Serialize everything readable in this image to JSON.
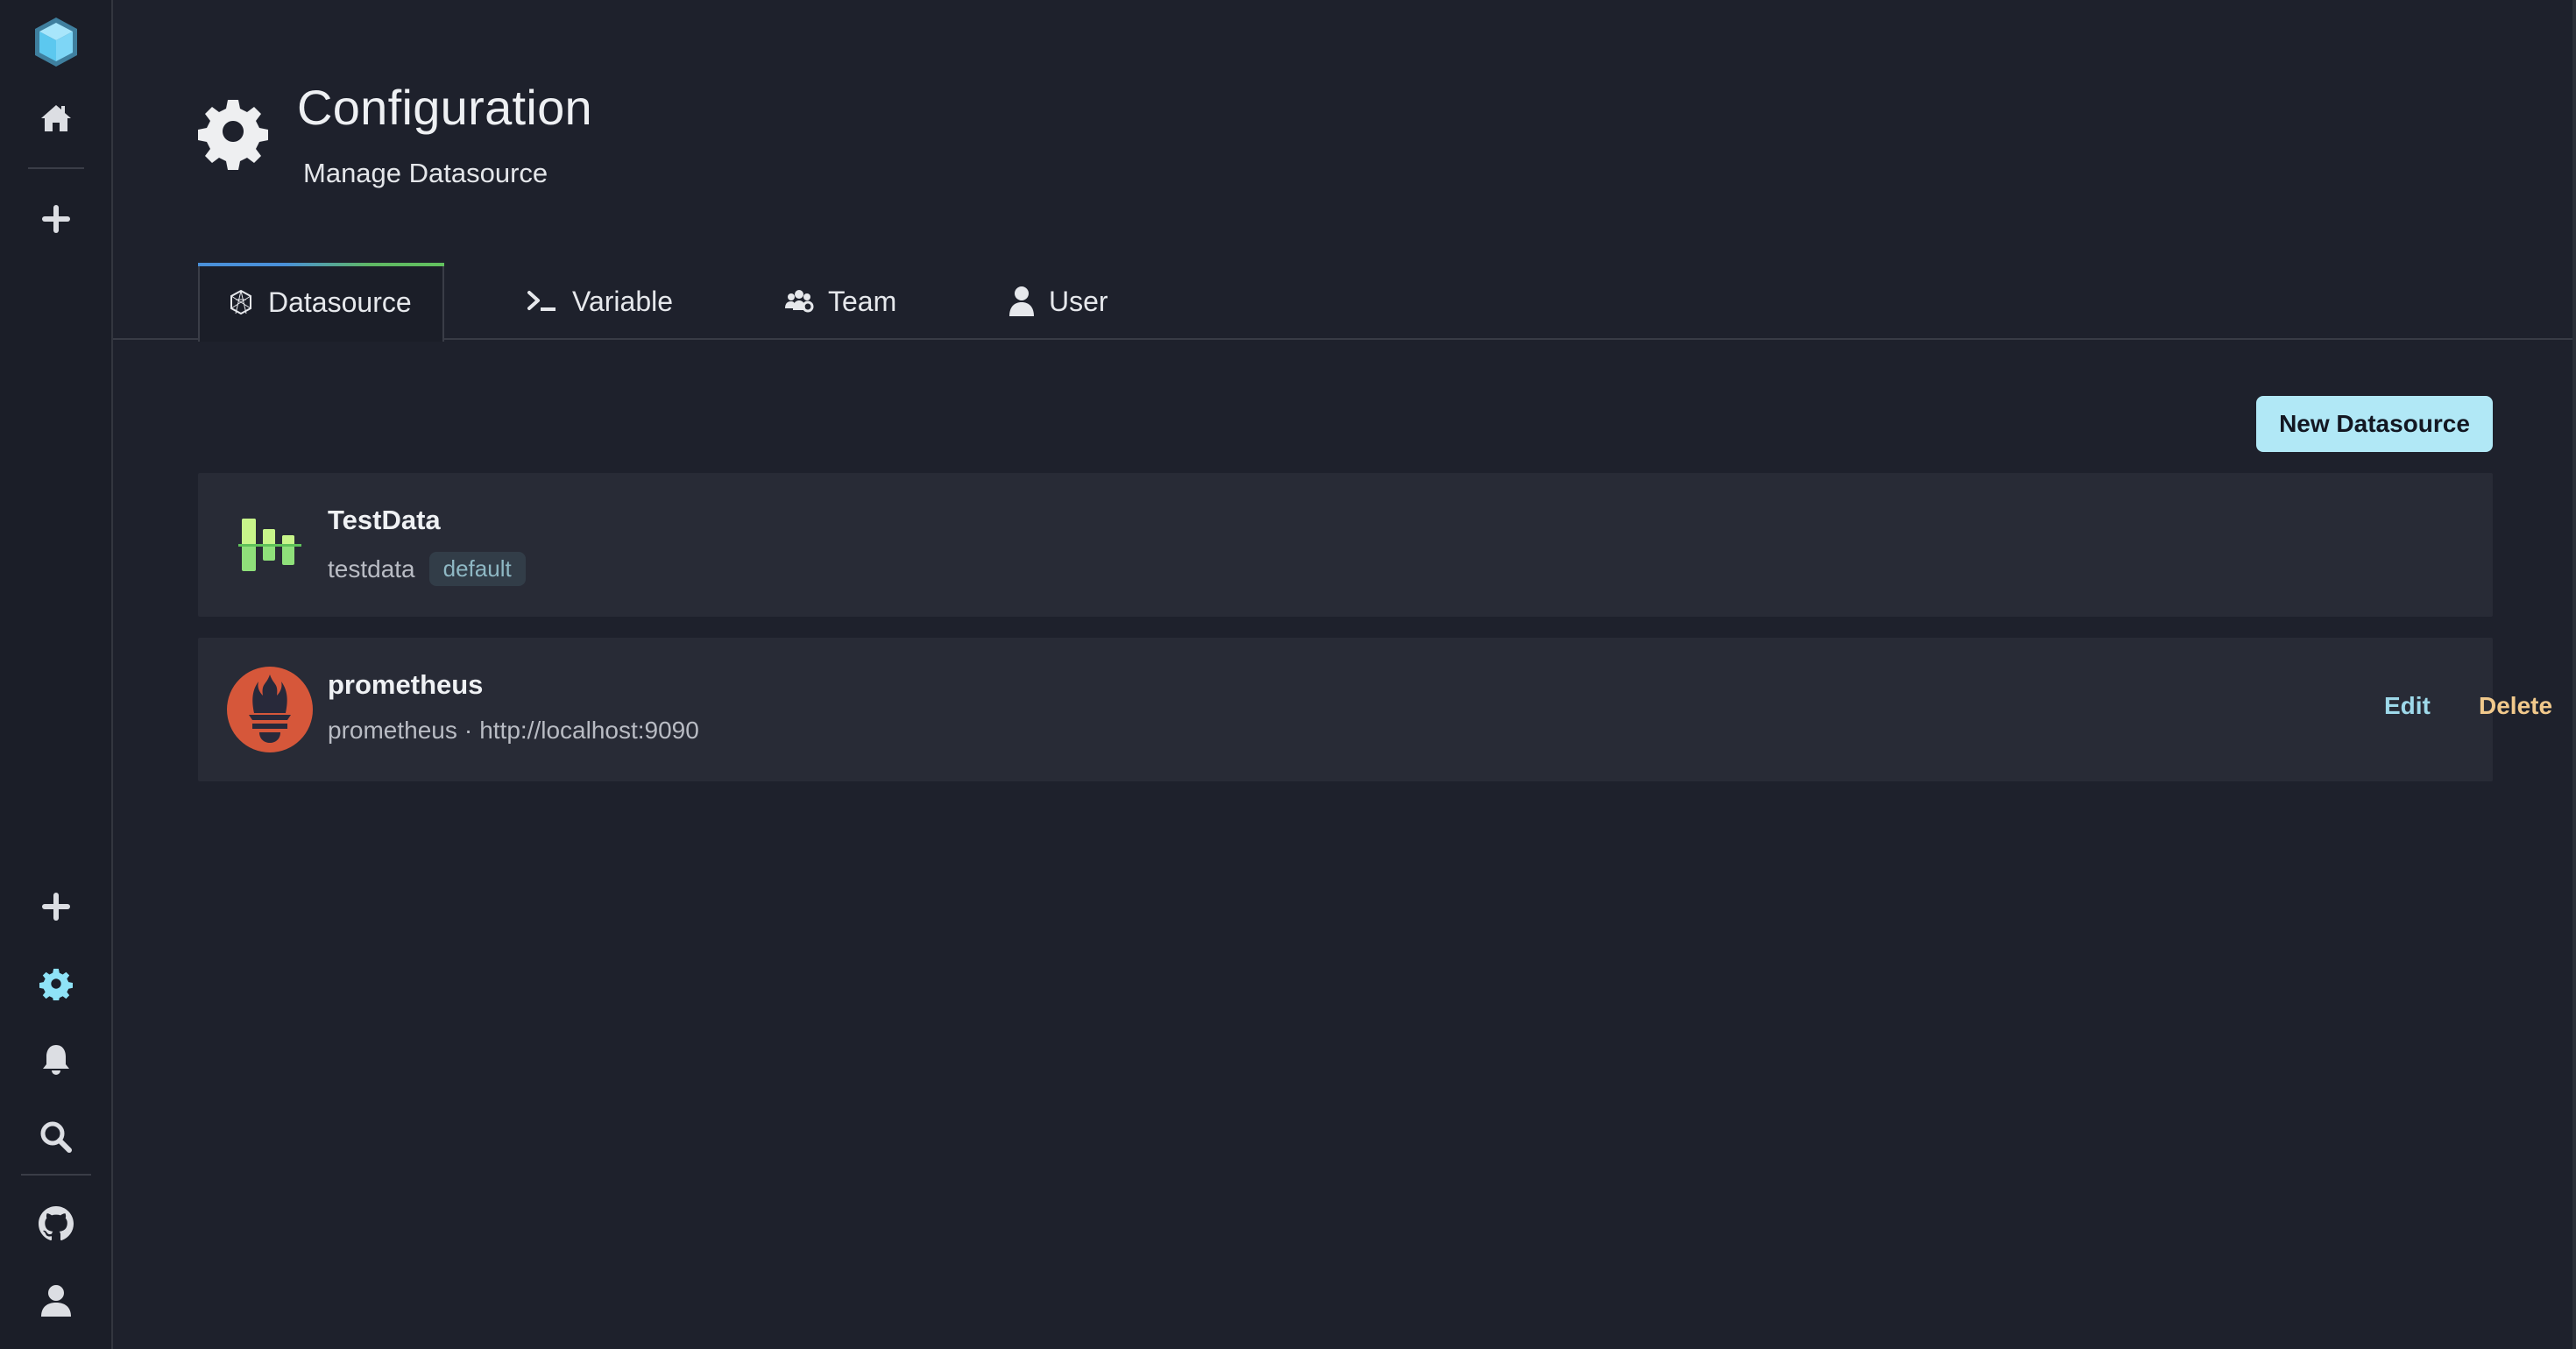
{
  "sidebar": {
    "top_items": [
      {
        "name": "logo",
        "icon": "cube-logo-icon"
      },
      {
        "name": "home",
        "icon": "home-icon"
      },
      {
        "name": "create",
        "icon": "plus-icon"
      }
    ],
    "bottom_items": [
      {
        "name": "add",
        "icon": "plus-icon"
      },
      {
        "name": "configuration",
        "icon": "gear-icon",
        "active": true
      },
      {
        "name": "alerts",
        "icon": "bell-icon"
      },
      {
        "name": "search",
        "icon": "search-icon"
      },
      {
        "name": "github",
        "icon": "github-icon"
      },
      {
        "name": "profile",
        "icon": "user-icon"
      }
    ],
    "active_color": "#8fe3f7"
  },
  "header": {
    "icon": "gear-icon",
    "title": "Configuration",
    "subtitle": "Manage Datasource"
  },
  "tabs": [
    {
      "label": "Datasource",
      "icon": "datasource-icon",
      "active": true
    },
    {
      "label": "Variable",
      "icon": "terminal-icon",
      "active": false
    },
    {
      "label": "Team",
      "icon": "team-icon",
      "active": false
    },
    {
      "label": "User",
      "icon": "user-icon",
      "active": false
    }
  ],
  "toolbar": {
    "new_datasource_label": "New Datasource"
  },
  "datasources": [
    {
      "name": "TestData",
      "type": "testdata",
      "url": "",
      "badge": "default",
      "logo": "testdata-logo-icon",
      "actions": []
    },
    {
      "name": "prometheus",
      "type": "prometheus",
      "separator": "·",
      "url": "http://localhost:9090",
      "badge": "",
      "logo": "prometheus-logo-icon",
      "actions": [
        "Edit",
        "Delete"
      ]
    }
  ],
  "colors": {
    "accent": "#b1e8f6",
    "edit": "#9ed9ea",
    "delete": "#f1c98c",
    "prometheus": "#d6573a",
    "testdata": "#8fe07a"
  }
}
